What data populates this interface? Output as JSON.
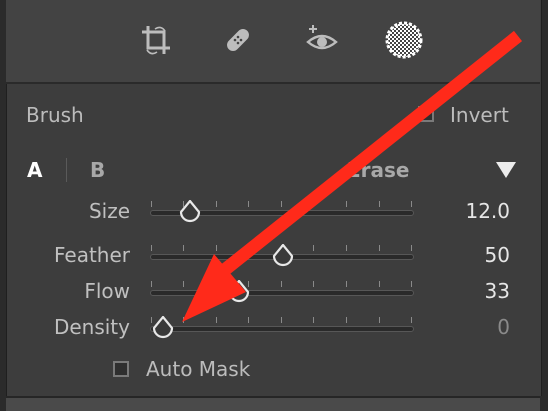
{
  "toolbar": {
    "icons": [
      "crop-icon",
      "healing-bandage-icon",
      "red-eye-icon",
      "brush-mask-icon"
    ]
  },
  "brush_section": {
    "title": "Brush",
    "invert_label": "Invert",
    "invert_checked": false
  },
  "tabs": {
    "a_label": "A",
    "b_label": "B",
    "erase_label": "Erase"
  },
  "sliders": [
    {
      "label": "Size",
      "value": "12.0",
      "position_fraction": 0.15
    },
    {
      "label": "Feather",
      "value": "50",
      "position_fraction": 0.5
    },
    {
      "label": "Flow",
      "value": "33",
      "position_fraction": 0.33
    },
    {
      "label": "Density",
      "value": "0",
      "position_fraction": 0.0
    }
  ],
  "auto_mask": {
    "label": "Auto Mask",
    "checked": false
  },
  "colors": {
    "panel_bg": "#3d3d3d",
    "annotation_arrow": "#ff2a1a"
  }
}
